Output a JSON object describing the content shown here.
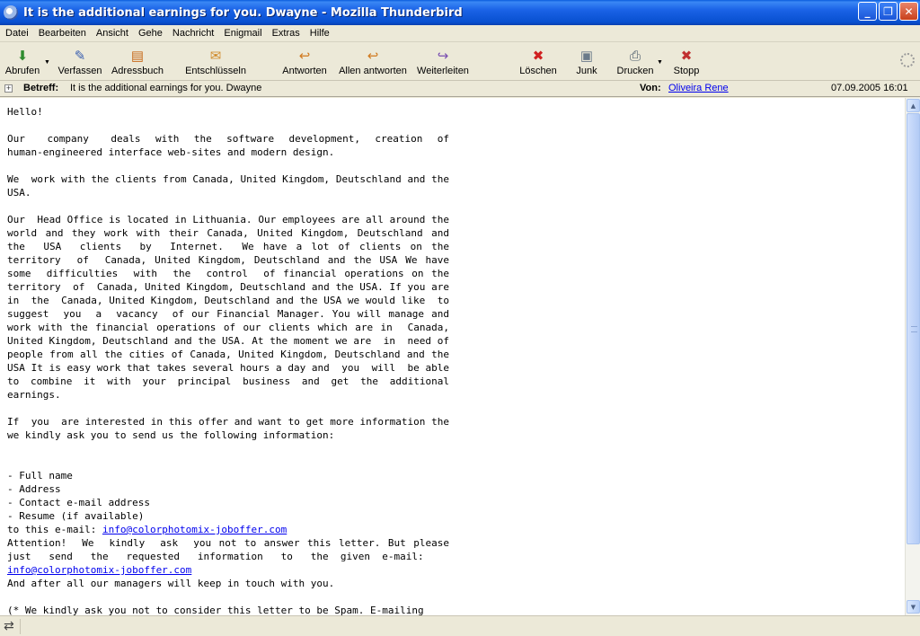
{
  "window": {
    "title": "It is the additional earnings for you. Dwayne - Mozilla Thunderbird",
    "minimize_glyph": "_",
    "maximize_glyph": "❐",
    "close_glyph": "✕"
  },
  "menu": [
    "Datei",
    "Bearbeiten",
    "Ansicht",
    "Gehe",
    "Nachricht",
    "Enigmail",
    "Extras",
    "Hilfe"
  ],
  "toolbar": {
    "buttons": [
      {
        "label": "Abrufen",
        "icon": "get-mail-icon",
        "glyph": "⬇",
        "color": "#2e8b2e"
      },
      {
        "label": "Verfassen",
        "icon": "compose-icon",
        "glyph": "✎",
        "color": "#3a5fb0"
      },
      {
        "label": "Adressbuch",
        "icon": "address-book-icon",
        "glyph": "▤",
        "color": "#c86a1a"
      },
      {
        "label": "Entschlüsseln",
        "icon": "decrypt-icon",
        "glyph": "✉",
        "color": "#d08a2a"
      },
      {
        "label": "Antworten",
        "icon": "reply-icon",
        "glyph": "↩",
        "color": "#d07a20"
      },
      {
        "label": "Allen antworten",
        "icon": "reply-all-icon",
        "glyph": "↩",
        "color": "#d07a20"
      },
      {
        "label": "Weiterleiten",
        "icon": "forward-icon",
        "glyph": "↪",
        "color": "#7a4fb0"
      },
      {
        "label": "Löschen",
        "icon": "delete-icon",
        "glyph": "✖",
        "color": "#d02020"
      },
      {
        "label": "Junk",
        "icon": "junk-icon",
        "glyph": "▣",
        "color": "#6a7a8a"
      },
      {
        "label": "Drucken",
        "icon": "print-icon",
        "glyph": "⎙",
        "color": "#4a5a6a"
      },
      {
        "label": "Stopp",
        "icon": "stop-icon",
        "glyph": "✖",
        "color": "#c03030"
      }
    ],
    "dropdown_glyph": "▼"
  },
  "header": {
    "subject_label": "Betreff:",
    "subject": "It is the additional earnings for you. Dwayne",
    "from_label": "Von:",
    "from": "Oliveira Rene",
    "date": "07.09.2005 16:01",
    "twisty_glyph": "+"
  },
  "message": {
    "greeting": "Hello!",
    "p1": "Our   company   deals  with  the  software  development,  creation  of human-engineered interface web-sites and modern design.",
    "p2": "We  work with the clients from Canada, United Kingdom, Deutschland and the USA.",
    "p3": "Our  Head Office is located in Lithuania. Our employees are all around the world and they work with their Canada, United Kingdom, Deutschland and  the  USA  clients  by  Internet.  We have a lot of clients on the territory  of  Canada, United Kingdom, Deutschland and the USA We have some  difficulties  with  the  control  of financial operations on the territory  of  Canada, United Kingdom, Deutschland and the USA. If you are  in  the  Canada, United Kingdom, Deutschland and the USA we would like  to  suggest  you  a  vacancy  of our Financial Manager. You will manage and work with the financial operations of our clients which are in  Canada,  United Kingdom, Deutschland and the USA. At the moment we are  in  need of people from all the cities of Canada, United Kingdom, Deutschland and the USA It is easy work that takes several hours a day and  you  will  be able to combine it with your principal business and get the additional earnings.",
    "p4": "If  you  are interested in this offer and want to get more information the we kindly ask you to send us the following information:",
    "list": [
      "- Full name",
      "- Address",
      "- Contact e-mail address",
      "- Resume (if available)"
    ],
    "send_to_prefix": "to this e-mail: ",
    "email": "info@colorphotomix-joboffer.com",
    "attention": "Attention!  We  kindly  ask  you not to answer this letter. But please just   send   the   requested   information   to   the  given  e-mail:",
    "email2": "info@colorphotomix-joboffer.com",
    "closing": "And after all our managers will keep in touch with you.",
    "footer_start": "(* We kindly ask you not to consider this letter to be Spam. E-mailing"
  },
  "scrollbar": {
    "up_glyph": "▲",
    "down_glyph": "▼"
  },
  "status": {
    "icon": "online-status-icon",
    "glyph": "⇄"
  }
}
